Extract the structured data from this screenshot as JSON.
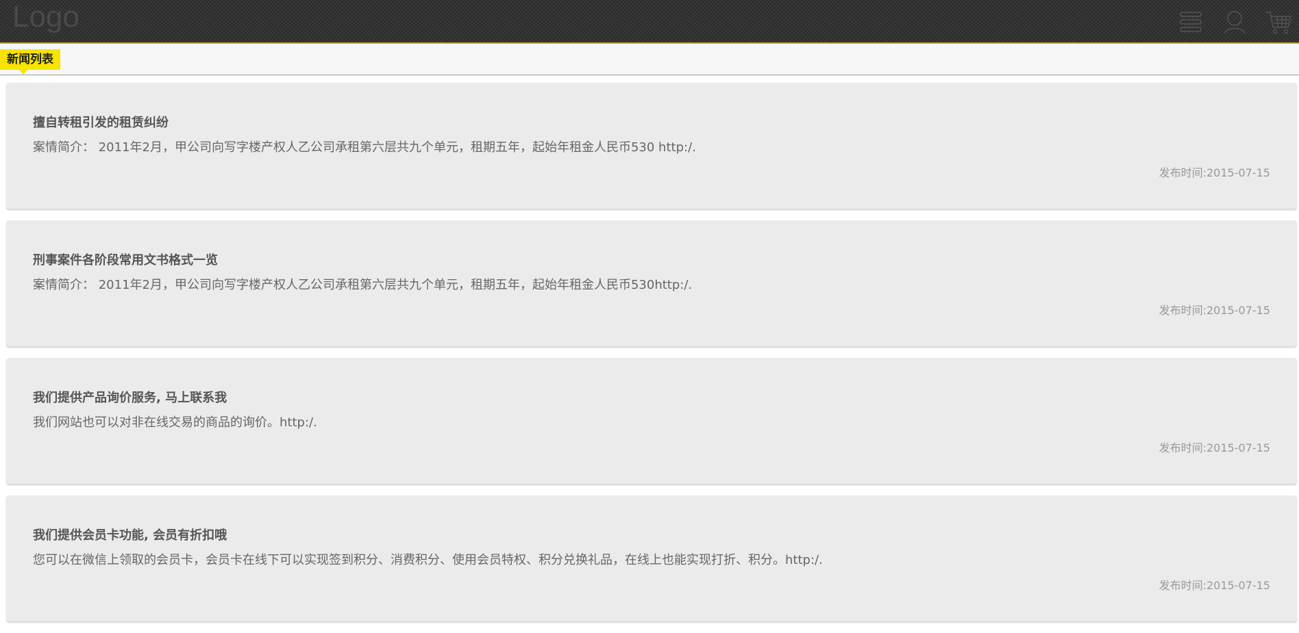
{
  "header": {
    "logo_text": "Logo",
    "icons": [
      "list-icon",
      "user-icon",
      "cart-icon"
    ]
  },
  "section": {
    "title": "新闻列表"
  },
  "news": [
    {
      "title": "擅自转租引发的租赁纠纷",
      "summary": "案情简介： 2011年2月，甲公司向写字楼产权人乙公司承租第六层共九个单元，租期五年，起始年租金人民币530 http:/.",
      "date": "发布时间:2015-07-15"
    },
    {
      "title": "刑事案件各阶段常用文书格式一览",
      "summary": "案情简介： 2011年2月，甲公司向写字楼产权人乙公司承租第六层共九个单元，租期五年，起始年租金人民币530http:/.",
      "date": "发布时间:2015-07-15"
    },
    {
      "title": "我们提供产品询价服务, 马上联系我",
      "summary": "我们网站也可以对非在线交易的商品的询价。http:/.",
      "date": "发布时间:2015-07-15"
    },
    {
      "title": "我们提供会员卡功能, 会员有折扣哦",
      "summary": "您可以在微信上领取的会员卡，会员卡在线下可以实现签到积分、消费积分、使用会员特权、积分兑换礼品，在线上也能实现打折、积分。http:/.",
      "date": "发布时间:2015-07-15"
    }
  ],
  "colors": {
    "topbar": "#333333",
    "topbar_border": "#c9a52a",
    "tag_background": "#f7e400",
    "card_background": "#ebebeb",
    "icon_stroke": "#4d4d4d"
  }
}
